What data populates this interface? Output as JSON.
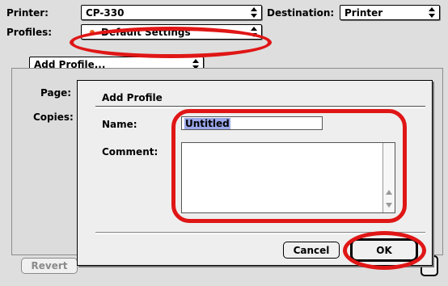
{
  "printer": {
    "label": "Printer:",
    "value": "CP-330"
  },
  "destination": {
    "label": "Destination:",
    "value": "Printer"
  },
  "profiles": {
    "label": "Profiles:",
    "value": "Default Settings"
  },
  "add_profile_menu": {
    "value": "Add Profile..."
  },
  "left_labels": {
    "page": "Page:",
    "copies": "Copies:"
  },
  "revert_button": {
    "label": "Revert"
  },
  "sheet": {
    "title": "Add Profile",
    "name_label": "Name:",
    "name_value": "Untitled",
    "comment_label": "Comment:",
    "comment_value": "",
    "cancel_label": "Cancel",
    "ok_label": "OK"
  },
  "colors": {
    "annotation": "#e01616",
    "selection": "#9aa6e8",
    "bullet": "#e8601c"
  }
}
